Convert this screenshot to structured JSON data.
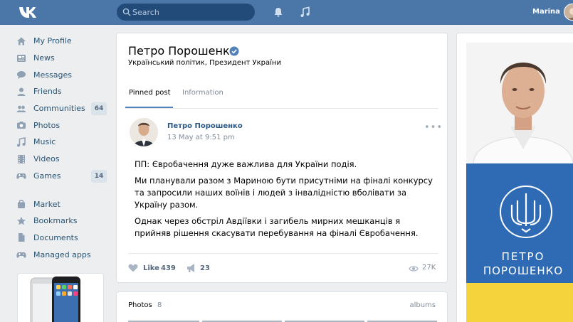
{
  "topbar": {
    "logo": "vk-logo",
    "search_placeholder": "Search",
    "user_name": "Marina",
    "icons": [
      "bell-icon",
      "music-icon"
    ]
  },
  "sidebar": {
    "items": [
      {
        "label": "My Profile",
        "icon": "home-icon"
      },
      {
        "label": "News",
        "icon": "news-icon"
      },
      {
        "label": "Messages",
        "icon": "messages-icon"
      },
      {
        "label": "Friends",
        "icon": "friend-icon"
      },
      {
        "label": "Communities",
        "icon": "communities-icon",
        "count": "64"
      },
      {
        "label": "Photos",
        "icon": "camera-icon"
      },
      {
        "label": "Music",
        "icon": "music-note-icon"
      },
      {
        "label": "Videos",
        "icon": "film-icon"
      },
      {
        "label": "Games",
        "icon": "gamepad-icon",
        "count": "14"
      }
    ],
    "items2": [
      {
        "label": "Market",
        "icon": "bag-icon"
      },
      {
        "label": "Bookmarks",
        "icon": "star-icon"
      },
      {
        "label": "Documents",
        "icon": "document-icon"
      },
      {
        "label": "Managed apps",
        "icon": "gamepad-icon"
      }
    ]
  },
  "profile": {
    "name": "Петро Порошенко",
    "status": "Український політик, Президент України",
    "tabs": [
      "Pinned post",
      "Information"
    ]
  },
  "post": {
    "author": "Петро Порошенко",
    "date": "13 May at 9:51 pm",
    "more": "•••",
    "paragraphs": [
      "ПП: Євробачення дуже важлива для України подія.",
      "Ми планували разом з Мариною бути присутніми на фіналі конкурсу та запросили наших воїнів і людей з інвалідністю вболівати за Україну разом.",
      "Однак через обстріл Авдіївки і загибель мирних мешканців я прийняв рішення скасувати перебування на фіналі Євробачення."
    ],
    "like_label": "Like",
    "likes": "439",
    "shares": "23",
    "views": "27K"
  },
  "photos": {
    "title": "Photos",
    "count": "8",
    "albums_link": "albums"
  },
  "poster": {
    "line1": "ПЕТРО",
    "line2": "ПОРОШЕНКО"
  },
  "colors": {
    "topbar": "#4a76a8",
    "link": "#2a5885",
    "background": "#edeef0",
    "flag_blue": "#2f6bb4",
    "flag_yellow": "#f5d33d"
  }
}
